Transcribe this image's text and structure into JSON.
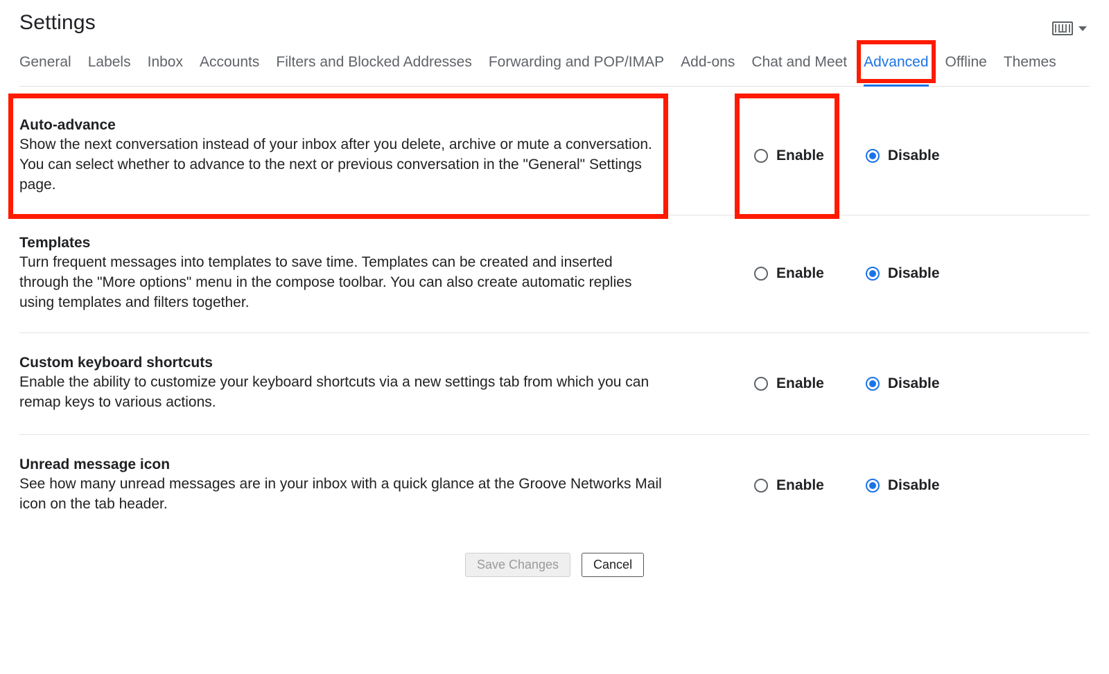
{
  "page_title": "Settings",
  "tabs": [
    {
      "label": "General",
      "active": false
    },
    {
      "label": "Labels",
      "active": false
    },
    {
      "label": "Inbox",
      "active": false
    },
    {
      "label": "Accounts",
      "active": false
    },
    {
      "label": "Filters and Blocked Addresses",
      "active": false
    },
    {
      "label": "Forwarding and POP/IMAP",
      "active": false
    },
    {
      "label": "Add-ons",
      "active": false
    },
    {
      "label": "Chat and Meet",
      "active": false
    },
    {
      "label": "Advanced",
      "active": true
    },
    {
      "label": "Offline",
      "active": false
    },
    {
      "label": "Themes",
      "active": false
    }
  ],
  "radio_labels": {
    "enable": "Enable",
    "disable": "Disable"
  },
  "settings": [
    {
      "key": "auto-advance",
      "title": "Auto-advance",
      "description": "Show the next conversation instead of your inbox after you delete, archive or mute a conversation. You can select whether to advance to the next or previous conversation in the \"General\" Settings page.",
      "value": "disable",
      "highlight_desc": true,
      "highlight_enable": true
    },
    {
      "key": "templates",
      "title": "Templates",
      "description": "Turn frequent messages into templates to save time. Templates can be created and inserted through the \"More options\" menu in the compose toolbar. You can also create automatic replies using templates and filters together.",
      "value": "disable"
    },
    {
      "key": "custom-keyboard-shortcuts",
      "title": "Custom keyboard shortcuts",
      "description": "Enable the ability to customize your keyboard shortcuts via a new settings tab from which you can remap keys to various actions.",
      "value": "disable"
    },
    {
      "key": "unread-message-icon",
      "title": "Unread message icon",
      "description": "See how many unread messages are in your inbox with a quick glance at the Groove Networks Mail icon on the tab header.",
      "value": "disable"
    }
  ],
  "actions": {
    "save": "Save Changes",
    "cancel": "Cancel"
  },
  "highlight_tab_index": 8
}
